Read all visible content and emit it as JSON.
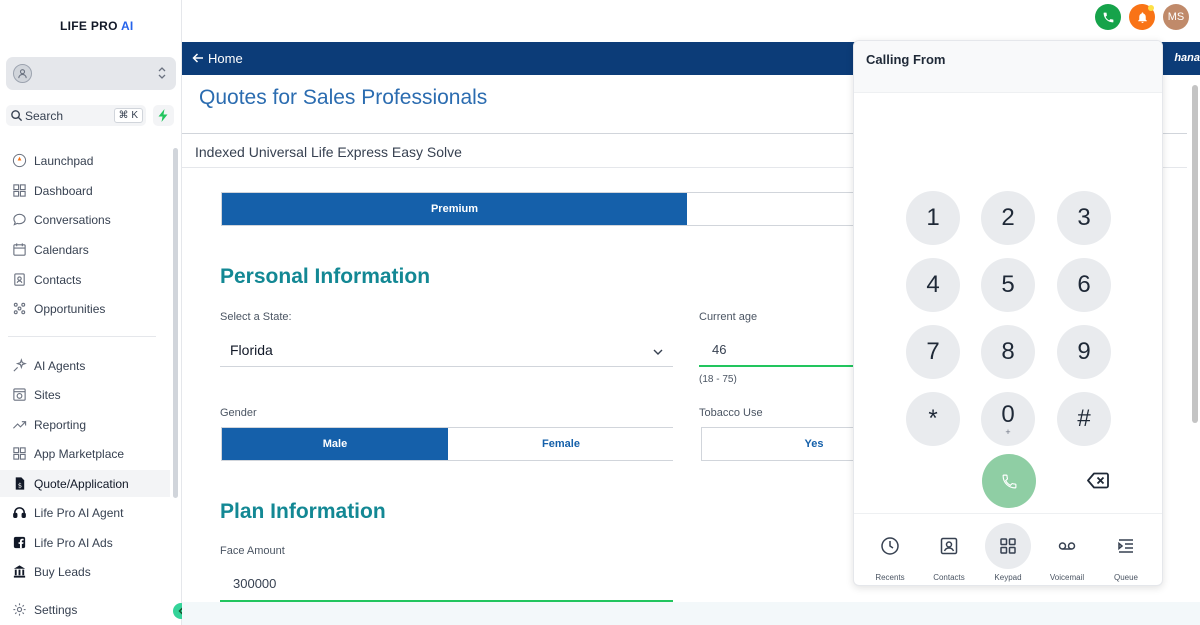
{
  "sidebar": {
    "logo_main": "LIFE PRO ",
    "logo_ai": "AI",
    "search_label": "Search",
    "search_shortcut": "⌘ K",
    "items": [
      {
        "label": "Launchpad"
      },
      {
        "label": "Dashboard"
      },
      {
        "label": "Conversations"
      },
      {
        "label": "Calendars"
      },
      {
        "label": "Contacts"
      },
      {
        "label": "Opportunities"
      },
      {
        "label": "AI Agents"
      },
      {
        "label": "Sites"
      },
      {
        "label": "Reporting"
      },
      {
        "label": "App Marketplace"
      },
      {
        "label": "Quote/Application"
      },
      {
        "label": "Life Pro AI Agent"
      },
      {
        "label": "Life Pro AI Ads"
      },
      {
        "label": "Buy Leads"
      }
    ],
    "settings_label": "Settings"
  },
  "topbar": {
    "user_initials": "MS"
  },
  "main": {
    "home_label": "Home",
    "brand_fragment": "hana",
    "page_title": "Quotes for Sales Professionals",
    "product": "Indexed Universal Life Express Easy Solve",
    "tab_premium": "Premium",
    "personal_heading": "Personal Information",
    "state_label": "Select a State:",
    "state_value": "Florida",
    "age_label": "Current age",
    "age_value": "46",
    "age_hint": "(18 - 75)",
    "gender_label": "Gender",
    "gender_male": "Male",
    "gender_female": "Female",
    "tobacco_label": "Tobacco Use",
    "tobacco_yes": "Yes",
    "plan_heading": "Plan Information",
    "face_label": "Face Amount",
    "face_value": "300000"
  },
  "dialer": {
    "title": "Calling From",
    "keys": [
      {
        "digit": "1",
        "sub": ""
      },
      {
        "digit": "2",
        "sub": ""
      },
      {
        "digit": "3",
        "sub": ""
      },
      {
        "digit": "4",
        "sub": ""
      },
      {
        "digit": "5",
        "sub": ""
      },
      {
        "digit": "6",
        "sub": ""
      },
      {
        "digit": "7",
        "sub": ""
      },
      {
        "digit": "8",
        "sub": ""
      },
      {
        "digit": "9",
        "sub": ""
      },
      {
        "digit": "*",
        "sub": ""
      },
      {
        "digit": "0",
        "sub": "+"
      },
      {
        "digit": "#",
        "sub": ""
      }
    ],
    "nav": [
      {
        "label": "Recents",
        "icon": "clock-icon"
      },
      {
        "label": "Contacts",
        "icon": "contact-card-icon"
      },
      {
        "label": "Keypad",
        "icon": "keypad-icon"
      },
      {
        "label": "Voicemail",
        "icon": "voicemail-icon"
      },
      {
        "label": "Queue",
        "icon": "queue-icon"
      }
    ]
  },
  "colors": {
    "header_navy": "#0c3c78",
    "primary_blue": "#1560aa",
    "teal_heading": "#138894",
    "success_green": "#16a34a",
    "call_button": "#8fcea4"
  }
}
